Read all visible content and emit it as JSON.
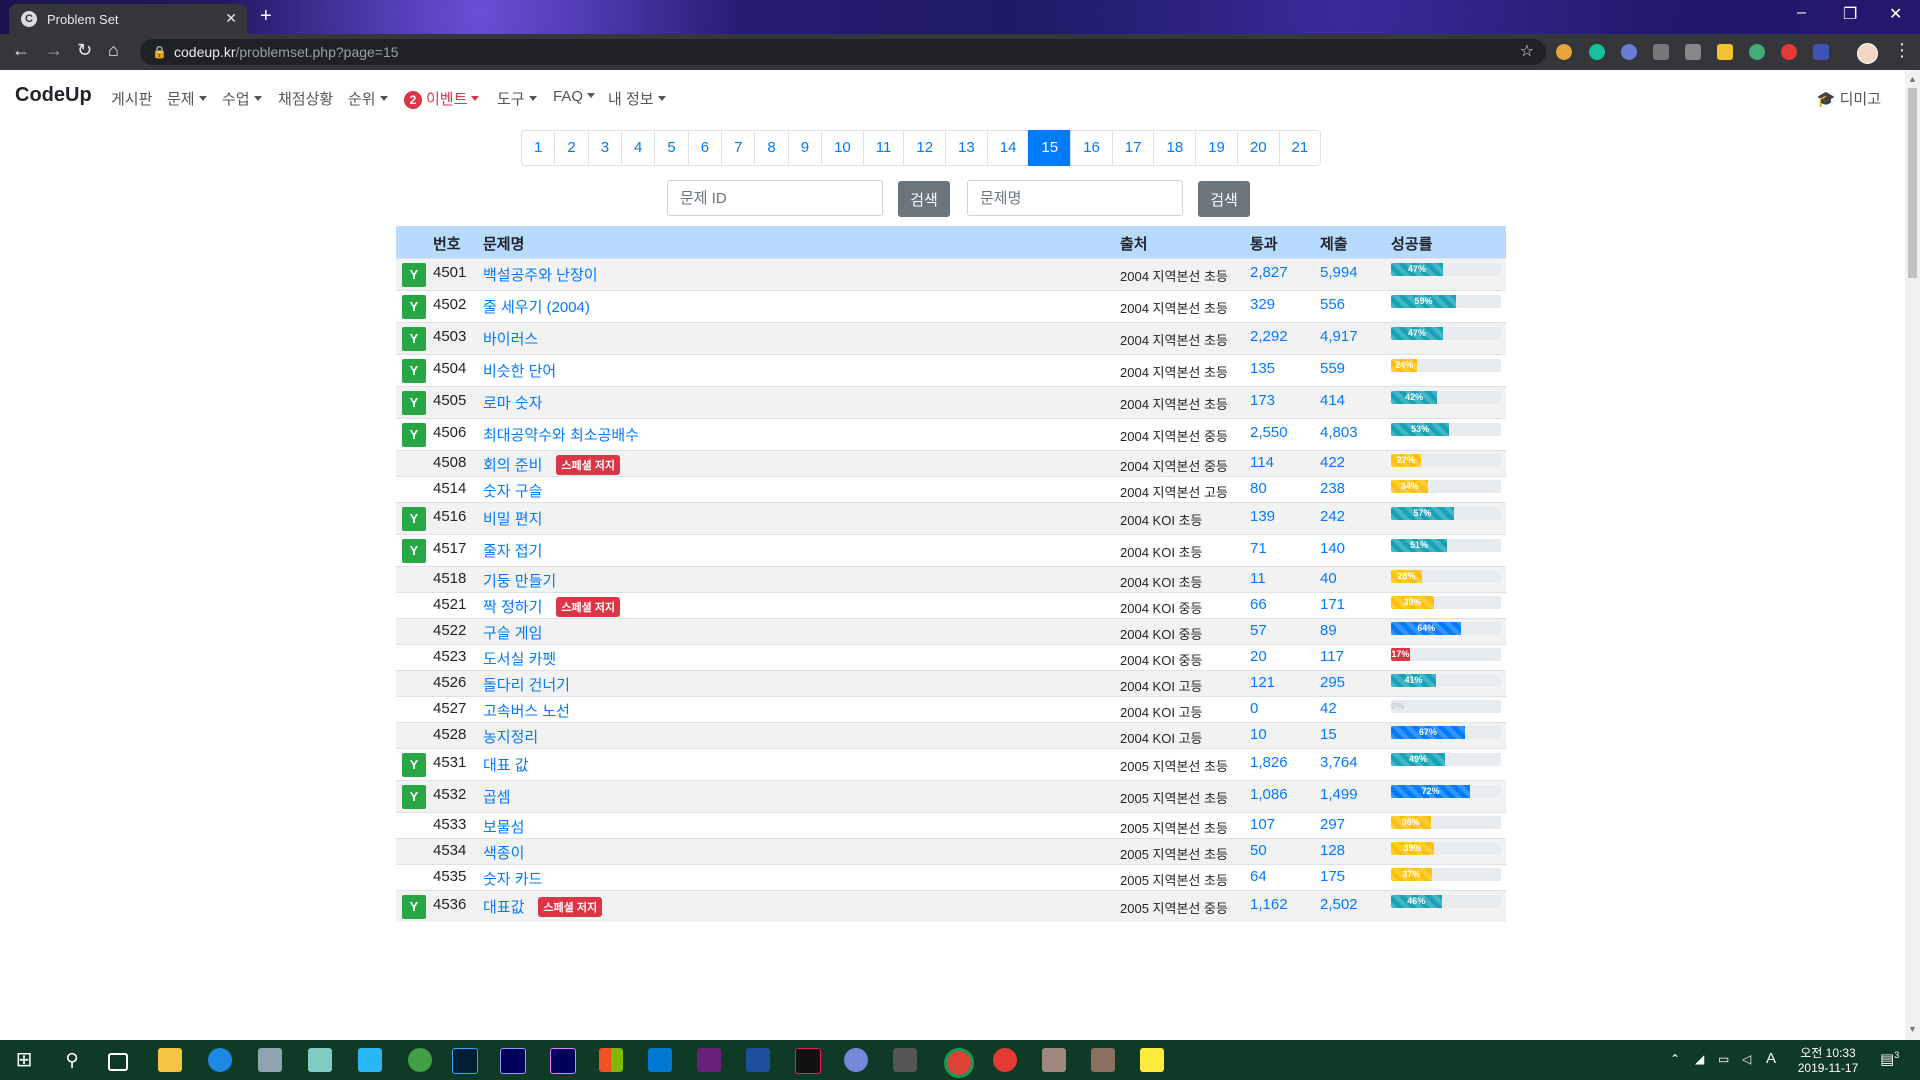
{
  "browser": {
    "tab_title": "Problem Set",
    "tab_favicon": "C",
    "url_host": "codeup.kr",
    "url_path": "/problemset.php?page=15"
  },
  "site": {
    "brand": "CodeUp",
    "nav": [
      "게시판",
      "문제",
      "수업",
      "채점상황",
      "순위"
    ],
    "event_badge": "2",
    "event_label": "이벤트",
    "nav2": [
      "도구",
      "FAQ",
      "내 정보"
    ],
    "user_label": "디미고"
  },
  "pagination": {
    "pages": [
      "1",
      "2",
      "3",
      "4",
      "5",
      "6",
      "7",
      "8",
      "9",
      "10",
      "11",
      "12",
      "13",
      "14",
      "15",
      "16",
      "17",
      "18",
      "19",
      "20",
      "21"
    ],
    "active": "15"
  },
  "search": {
    "id_placeholder": "문제 ID",
    "id_button": "검색",
    "title_placeholder": "문제명",
    "title_button": "검색"
  },
  "table": {
    "headers": [
      "번호",
      "문제명",
      "출처",
      "통과",
      "제출",
      "성공률"
    ],
    "special_judge_label": "스페셜 저지",
    "rows": [
      {
        "solved": "Y",
        "id": "4501",
        "title": "백설공주와 난장이",
        "special": false,
        "source": "2004 지역본선 초등",
        "accepted": "2,827",
        "submitted": "5,994",
        "rate": 47,
        "rate_label": "47%",
        "color": "info"
      },
      {
        "solved": "Y",
        "id": "4502",
        "title": "줄 세우기 (2004)",
        "special": false,
        "source": "2004 지역본선 초등",
        "accepted": "329",
        "submitted": "556",
        "rate": 59,
        "rate_label": "59%",
        "color": "info"
      },
      {
        "solved": "Y",
        "id": "4503",
        "title": "바이러스",
        "special": false,
        "source": "2004 지역본선 초등",
        "accepted": "2,292",
        "submitted": "4,917",
        "rate": 47,
        "rate_label": "47%",
        "color": "info"
      },
      {
        "solved": "Y",
        "id": "4504",
        "title": "비슷한 단어",
        "special": false,
        "source": "2004 지역본선 초등",
        "accepted": "135",
        "submitted": "559",
        "rate": 24,
        "rate_label": "24%",
        "color": "warning"
      },
      {
        "solved": "Y",
        "id": "4505",
        "title": "로마 숫자",
        "special": false,
        "source": "2004 지역본선 초등",
        "accepted": "173",
        "submitted": "414",
        "rate": 42,
        "rate_label": "42%",
        "color": "info"
      },
      {
        "solved": "Y",
        "id": "4506",
        "title": "최대공약수와 최소공배수",
        "special": false,
        "source": "2004 지역본선 중등",
        "accepted": "2,550",
        "submitted": "4,803",
        "rate": 53,
        "rate_label": "53%",
        "color": "info"
      },
      {
        "solved": "",
        "id": "4508",
        "title": "회의 준비",
        "special": true,
        "source": "2004 지역본선 중등",
        "accepted": "114",
        "submitted": "422",
        "rate": 27,
        "rate_label": "27%",
        "color": "warning"
      },
      {
        "solved": "",
        "id": "4514",
        "title": "숫자 구슬",
        "special": false,
        "source": "2004 지역본선 고등",
        "accepted": "80",
        "submitted": "238",
        "rate": 34,
        "rate_label": "34%",
        "color": "warning"
      },
      {
        "solved": "Y",
        "id": "4516",
        "title": "비밀 편지",
        "special": false,
        "source": "2004 KOI 초등",
        "accepted": "139",
        "submitted": "242",
        "rate": 57,
        "rate_label": "57%",
        "color": "info"
      },
      {
        "solved": "Y",
        "id": "4517",
        "title": "줄자 접기",
        "special": false,
        "source": "2004 KOI 초등",
        "accepted": "71",
        "submitted": "140",
        "rate": 51,
        "rate_label": "51%",
        "color": "info"
      },
      {
        "solved": "",
        "id": "4518",
        "title": "기둥 만들기",
        "special": false,
        "source": "2004 KOI 초등",
        "accepted": "11",
        "submitted": "40",
        "rate": 28,
        "rate_label": "28%",
        "color": "warning"
      },
      {
        "solved": "",
        "id": "4521",
        "title": "짝 정하기",
        "special": true,
        "source": "2004 KOI 중등",
        "accepted": "66",
        "submitted": "171",
        "rate": 39,
        "rate_label": "39%",
        "color": "warning"
      },
      {
        "solved": "",
        "id": "4522",
        "title": "구슬 게임",
        "special": false,
        "source": "2004 KOI 중등",
        "accepted": "57",
        "submitted": "89",
        "rate": 64,
        "rate_label": "64%",
        "color": "primary"
      },
      {
        "solved": "",
        "id": "4523",
        "title": "도서실 카펫",
        "special": false,
        "source": "2004 KOI 중등",
        "accepted": "20",
        "submitted": "117",
        "rate": 17,
        "rate_label": "17%",
        "color": "danger"
      },
      {
        "solved": "",
        "id": "4526",
        "title": "돌다리 건너기",
        "special": false,
        "source": "2004 KOI 고등",
        "accepted": "121",
        "submitted": "295",
        "rate": 41,
        "rate_label": "41%",
        "color": "info"
      },
      {
        "solved": "",
        "id": "4527",
        "title": "고속버스 노선",
        "special": false,
        "source": "2004 KOI 고등",
        "accepted": "0",
        "submitted": "42",
        "rate": 0,
        "rate_label": "0%",
        "color": "zero"
      },
      {
        "solved": "",
        "id": "4528",
        "title": "농지정리",
        "special": false,
        "source": "2004 KOI 고등",
        "accepted": "10",
        "submitted": "15",
        "rate": 67,
        "rate_label": "67%",
        "color": "primary"
      },
      {
        "solved": "Y",
        "id": "4531",
        "title": "대표 값",
        "special": false,
        "source": "2005 지역본선 초등",
        "accepted": "1,826",
        "submitted": "3,764",
        "rate": 49,
        "rate_label": "49%",
        "color": "info"
      },
      {
        "solved": "Y",
        "id": "4532",
        "title": "곱셈",
        "special": false,
        "source": "2005 지역본선 초등",
        "accepted": "1,086",
        "submitted": "1,499",
        "rate": 72,
        "rate_label": "72%",
        "color": "primary"
      },
      {
        "solved": "",
        "id": "4533",
        "title": "보물섬",
        "special": false,
        "source": "2005 지역본선 초등",
        "accepted": "107",
        "submitted": "297",
        "rate": 36,
        "rate_label": "36%",
        "color": "warning"
      },
      {
        "solved": "",
        "id": "4534",
        "title": "색종이",
        "special": false,
        "source": "2005 지역본선 초등",
        "accepted": "50",
        "submitted": "128",
        "rate": 39,
        "rate_label": "39%",
        "color": "warning"
      },
      {
        "solved": "",
        "id": "4535",
        "title": "숫자 카드",
        "special": false,
        "source": "2005 지역본선 초등",
        "accepted": "64",
        "submitted": "175",
        "rate": 37,
        "rate_label": "37%",
        "color": "warning"
      },
      {
        "solved": "Y",
        "id": "4536",
        "title": "대표값",
        "special": true,
        "source": "2005 지역본선 중등",
        "accepted": "1,162",
        "submitted": "2,502",
        "rate": 46,
        "rate_label": "46%",
        "color": "info"
      }
    ]
  },
  "taskbar": {
    "time": "오전 10:33",
    "date": "2019-11-17",
    "ime": "A",
    "notification_count": "3"
  },
  "colors": {
    "link": "#007bff",
    "header_bg": "#b8daff",
    "solved_badge": "#28a745",
    "special_badge": "#dc3545"
  }
}
